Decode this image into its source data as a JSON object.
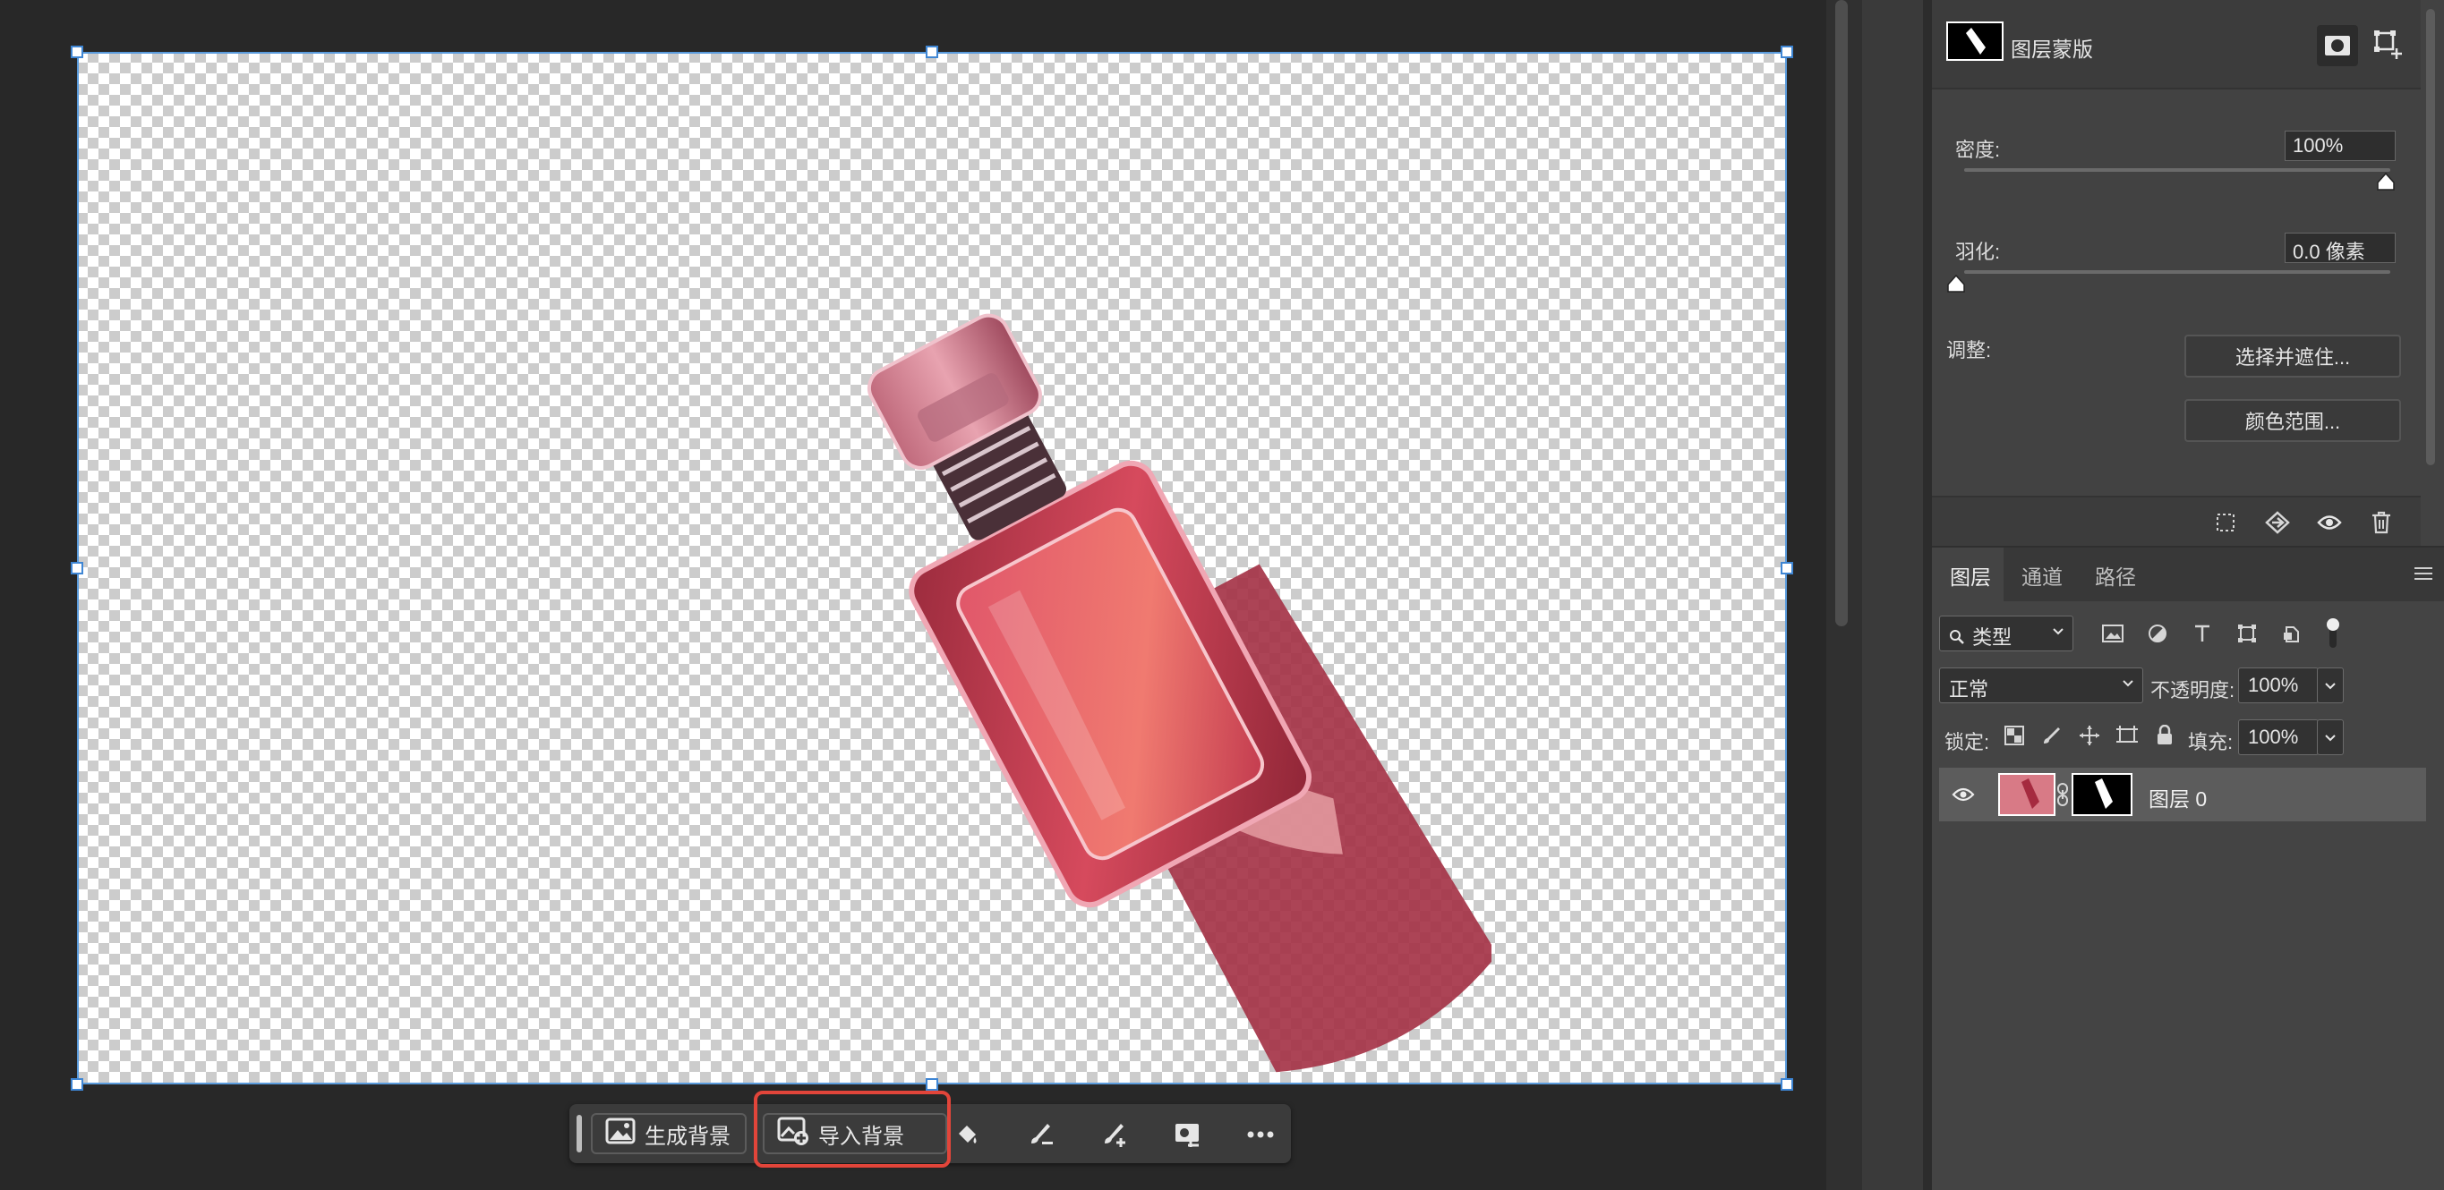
{
  "taskbar": {
    "generate_background_label": "生成背景",
    "import_background_label": "导入背景",
    "icons": [
      "fill-bucket-icon",
      "brush-subtract-icon",
      "brush-add-icon",
      "mask-settings-icon",
      "more-icon"
    ]
  },
  "properties": {
    "title": "图层蒙版",
    "density_label": "密度:",
    "density_value": "100%",
    "density_level": 1.0,
    "feather_label": "羽化:",
    "feather_value": "0.0 像素",
    "feather_level": 0.0,
    "adjust_label": "调整:",
    "select_and_mask_button": "选择并遮住...",
    "color_range_button": "颜色范围..."
  },
  "layers": {
    "tabs": [
      "图层",
      "通道",
      "路径"
    ],
    "active_tab": "图层",
    "filter_kind": "类型",
    "blend_mode": "正常",
    "opacity_label": "不透明度:",
    "opacity_value": "100%",
    "lock_label": "锁定:",
    "fill_label": "填充:",
    "fill_value": "100%",
    "items": [
      {
        "name": "图层 0",
        "visible": true,
        "has_mask": true
      }
    ]
  },
  "colors": {
    "selection_box": "#3f86d4",
    "highlight": "#e2453a",
    "bottle": "#b8384e"
  }
}
